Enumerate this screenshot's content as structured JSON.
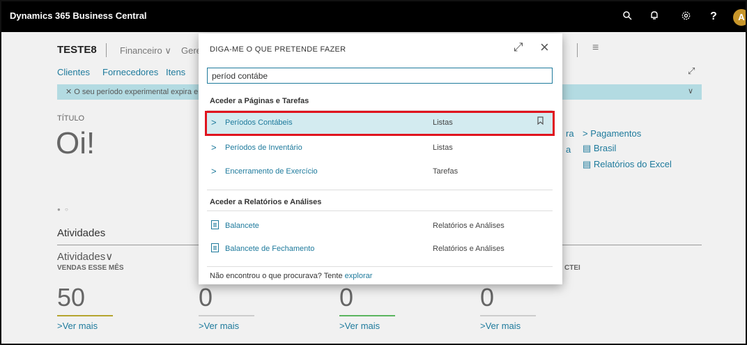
{
  "app": {
    "title": "Dynamics 365 Business Central",
    "icons": [
      "search-icon",
      "bell-icon",
      "gear-icon",
      "help-icon"
    ],
    "help_glyph": "?",
    "avatar_initial": "A",
    "avatar_color": "#c8962a"
  },
  "page": {
    "company": "TESTE8",
    "nav": [
      "Financeiro",
      "Gere"
    ],
    "subnav": [
      "Clientes",
      "Fornecedores",
      "Itens"
    ],
    "banner": "✕  O seu período experimental expira e",
    "titulo_label": "TÍTULO",
    "greeting": "Oi!",
    "atividades_heading": "Atividades",
    "atividades_sub": "Atividades",
    "kpis": [
      {
        "label": "VENDAS ESSE MÊS",
        "value": "50",
        "more": "Ver mais",
        "bar_color": "#b5a52f"
      },
      {
        "label": "",
        "value": "0",
        "more": "Ver mais",
        "bar_color": "#cccccc"
      },
      {
        "label": "",
        "value": "0",
        "more": "Ver mais",
        "bar_color": "#5bb55f"
      },
      {
        "label": "CTEI",
        "value": "0",
        "more": "Ver mais",
        "bar_color": "#cccccc"
      }
    ],
    "right_links": {
      "pagamentos": "Pagamentos",
      "brasil": "Brasil",
      "relatorios_excel": "Relatórios do Excel",
      "partial_ra": "ra",
      "partial_a": "a"
    }
  },
  "dialog": {
    "title": "DIGA-ME O QUE PRETENDE FAZER",
    "search_value": "períod contábe",
    "section_pages": "Aceder a Páginas e Tarefas",
    "pages": [
      {
        "label": "Períodos Contábeis",
        "category": "Listas",
        "selected": true
      },
      {
        "label": "Períodos de Inventário",
        "category": "Listas"
      },
      {
        "label": "Encerramento de Exercício",
        "category": "Tarefas"
      }
    ],
    "section_reports": "Aceder a Relatórios e Análises",
    "reports": [
      {
        "label": "Balancete",
        "category": "Relatórios e Análises"
      },
      {
        "label": "Balancete de Fechamento",
        "category": "Relatórios e Análises"
      }
    ],
    "footer_text": "Não encontrou o que procurava? Tente ",
    "footer_link": "explorar",
    "accent_color": "#1e7a9c",
    "highlight_color": "#e0141e"
  }
}
